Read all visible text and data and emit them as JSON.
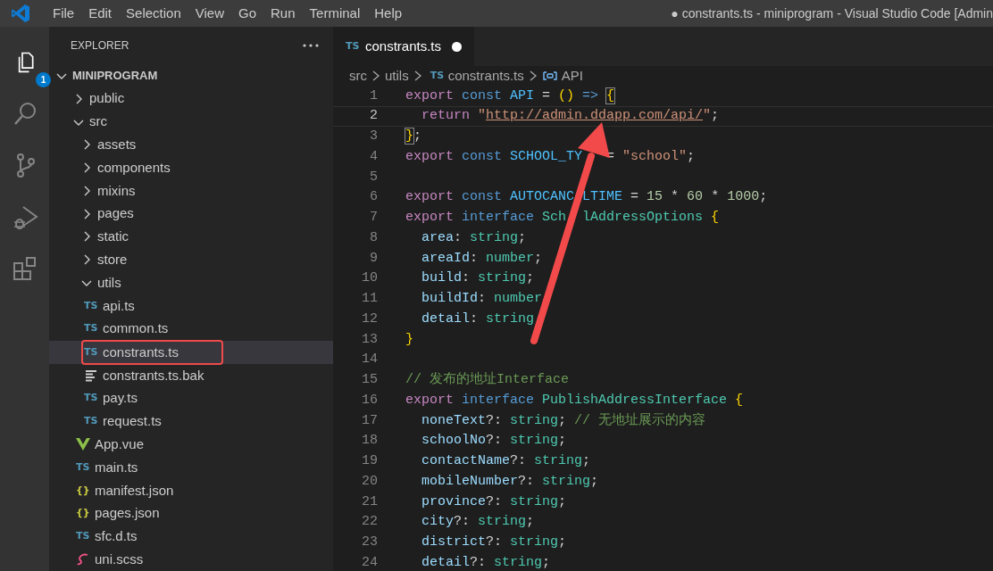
{
  "title_bar": {
    "menus": [
      "File",
      "Edit",
      "Selection",
      "View",
      "Go",
      "Run",
      "Terminal",
      "Help"
    ],
    "title": "● constrants.ts - miniprogram - Visual Studio Code [Admin"
  },
  "activity_bar": {
    "items": [
      {
        "kind": "explorer",
        "selected": true,
        "badge": "1"
      },
      {
        "kind": "search",
        "selected": false
      },
      {
        "kind": "source-control",
        "selected": false
      },
      {
        "kind": "run-debug",
        "selected": false
      },
      {
        "kind": "extensions",
        "selected": false
      }
    ]
  },
  "explorer": {
    "title": "EXPLORER",
    "root": {
      "label": "MINIPROGRAM",
      "expanded": true,
      "children": [
        {
          "kind": "folder",
          "label": "public",
          "expanded": false,
          "selected": false,
          "boxed": false
        },
        {
          "kind": "folder",
          "label": "src",
          "expanded": true,
          "selected": false,
          "boxed": false,
          "children": [
            {
              "kind": "folder",
              "label": "assets",
              "expanded": false,
              "selected": false,
              "boxed": false
            },
            {
              "kind": "folder",
              "label": "components",
              "expanded": false,
              "selected": false,
              "boxed": false
            },
            {
              "kind": "folder",
              "label": "mixins",
              "expanded": false,
              "selected": false,
              "boxed": false
            },
            {
              "kind": "folder",
              "label": "pages",
              "expanded": false,
              "selected": false,
              "boxed": false
            },
            {
              "kind": "folder",
              "label": "static",
              "expanded": false,
              "selected": false,
              "boxed": false
            },
            {
              "kind": "folder",
              "label": "store",
              "expanded": false,
              "selected": false,
              "boxed": false
            },
            {
              "kind": "folder",
              "label": "utils",
              "expanded": true,
              "selected": false,
              "boxed": false,
              "children": [
                {
                  "kind": "ts",
                  "badge": "TS",
                  "label": "api.ts",
                  "selected": false,
                  "boxed": false
                },
                {
                  "kind": "ts",
                  "badge": "TS",
                  "label": "common.ts",
                  "selected": false,
                  "boxed": false
                },
                {
                  "kind": "ts",
                  "badge": "TS",
                  "label": "constrants.ts",
                  "selected": true,
                  "boxed": true
                },
                {
                  "kind": "text",
                  "label": "constrants.ts.bak",
                  "selected": false,
                  "boxed": false
                },
                {
                  "kind": "ts",
                  "badge": "TS",
                  "label": "pay.ts",
                  "selected": false,
                  "boxed": false
                },
                {
                  "kind": "ts",
                  "badge": "TS",
                  "label": "request.ts",
                  "selected": false,
                  "boxed": false
                }
              ]
            },
            {
              "kind": "vue",
              "label": "App.vue",
              "selected": false,
              "boxed": false
            },
            {
              "kind": "ts",
              "badge": "TS",
              "label": "main.ts",
              "selected": false,
              "boxed": false
            },
            {
              "kind": "json",
              "badge": "{}",
              "label": "manifest.json",
              "selected": false,
              "boxed": false
            },
            {
              "kind": "json",
              "badge": "{}",
              "label": "pages.json",
              "selected": false,
              "boxed": false
            },
            {
              "kind": "ts",
              "badge": "TS",
              "label": "sfc.d.ts",
              "selected": false,
              "boxed": false
            },
            {
              "kind": "scss",
              "label": "uni.scss",
              "selected": false,
              "boxed": false
            }
          ]
        }
      ]
    }
  },
  "editor": {
    "tabs": [
      {
        "badge": "TS",
        "label": "constrants.ts",
        "selected": true,
        "modified": true
      }
    ],
    "breadcrumb": [
      {
        "kind": "folder",
        "label": "src"
      },
      {
        "kind": "folder",
        "label": "utils"
      },
      {
        "kind": "file",
        "badge": "TS",
        "label": "constrants.ts"
      },
      {
        "kind": "symbol",
        "label": "API"
      }
    ],
    "lines": [
      {
        "number": "1",
        "current": false,
        "tokens": [
          {
            "kind": "keyword",
            "text": "export"
          },
          {
            "kind": "storage",
            "text": " const"
          },
          {
            "kind": "constant",
            "text": " API"
          },
          {
            "kind": "plain",
            "text": " = "
          },
          {
            "kind": "bracket",
            "text": "()"
          },
          {
            "kind": "storage",
            "text": " => "
          },
          {
            "kind": "bracket-match",
            "text": "{"
          }
        ]
      },
      {
        "number": "2",
        "current": true,
        "tokens": [
          {
            "kind": "keyword",
            "text": "  return"
          },
          {
            "kind": "string",
            "text": " \""
          },
          {
            "kind": "link",
            "text": "http://admin.ddapp.com/api/"
          },
          {
            "kind": "string",
            "text": "\""
          },
          {
            "kind": "plain",
            "text": ";"
          }
        ]
      },
      {
        "number": "3",
        "current": false,
        "tokens": [
          {
            "kind": "bracket-match",
            "text": "}"
          },
          {
            "kind": "plain",
            "text": ";"
          }
        ]
      },
      {
        "number": "4",
        "current": false,
        "tokens": [
          {
            "kind": "keyword",
            "text": "export"
          },
          {
            "kind": "storage",
            "text": " const"
          },
          {
            "kind": "constant",
            "text": " SCHOOL_TY"
          },
          {
            "kind": "covered"
          },
          {
            "kind": "covered"
          },
          {
            "kind": "plain",
            "text": " = "
          },
          {
            "kind": "string",
            "text": "\"school\""
          },
          {
            "kind": "plain",
            "text": ";"
          }
        ]
      },
      {
        "number": "5",
        "current": false
      },
      {
        "number": "6",
        "current": false,
        "tokens": [
          {
            "kind": "keyword",
            "text": "export"
          },
          {
            "kind": "storage",
            "text": " const"
          },
          {
            "kind": "constant",
            "text": " AUTOCANC"
          },
          {
            "kind": "covered"
          },
          {
            "kind": "constant",
            "text": "LTIME"
          },
          {
            "kind": "plain",
            "text": " = "
          },
          {
            "kind": "number",
            "text": "15"
          },
          {
            "kind": "plain",
            "text": " * "
          },
          {
            "kind": "number",
            "text": "60"
          },
          {
            "kind": "plain",
            "text": " * "
          },
          {
            "kind": "number",
            "text": "1000"
          },
          {
            "kind": "plain",
            "text": ";"
          }
        ]
      },
      {
        "number": "7",
        "current": false,
        "tokens": [
          {
            "kind": "keyword",
            "text": "export"
          },
          {
            "kind": "storage",
            "text": " interface"
          },
          {
            "kind": "type",
            "text": " Sch"
          },
          {
            "kind": "covered"
          },
          {
            "kind": "covered"
          },
          {
            "kind": "type",
            "text": "lAddressOptions"
          },
          {
            "kind": "bracket",
            "text": " {"
          }
        ]
      },
      {
        "number": "8",
        "current": false,
        "tokens": [
          {
            "kind": "property",
            "text": "  area"
          },
          {
            "kind": "plain",
            "text": ": "
          },
          {
            "kind": "type",
            "text": "string"
          },
          {
            "kind": "plain",
            "text": ";"
          }
        ]
      },
      {
        "number": "9",
        "current": false,
        "tokens": [
          {
            "kind": "property",
            "text": "  areaId"
          },
          {
            "kind": "plain",
            "text": ": "
          },
          {
            "kind": "type",
            "text": "number"
          },
          {
            "kind": "plain",
            "text": ";"
          }
        ]
      },
      {
        "number": "10",
        "current": false,
        "tokens": [
          {
            "kind": "property",
            "text": "  build"
          },
          {
            "kind": "plain",
            "text": ": "
          },
          {
            "kind": "type",
            "text": "string"
          },
          {
            "kind": "plain",
            "text": ";"
          }
        ]
      },
      {
        "number": "11",
        "current": false,
        "tokens": [
          {
            "kind": "property",
            "text": "  buildId"
          },
          {
            "kind": "plain",
            "text": ": "
          },
          {
            "kind": "type",
            "text": "number"
          },
          {
            "kind": "covered"
          }
        ]
      },
      {
        "number": "12",
        "current": false,
        "tokens": [
          {
            "kind": "property",
            "text": "  detail"
          },
          {
            "kind": "plain",
            "text": ": "
          },
          {
            "kind": "type",
            "text": "string"
          },
          {
            "kind": "covered"
          }
        ]
      },
      {
        "number": "13",
        "current": false,
        "tokens": [
          {
            "kind": "bracket",
            "text": "}"
          }
        ]
      },
      {
        "number": "14",
        "current": false
      },
      {
        "number": "15",
        "current": false,
        "tokens": [
          {
            "kind": "comment",
            "text": "// 发布的地址Interface"
          }
        ]
      },
      {
        "number": "16",
        "current": false,
        "tokens": [
          {
            "kind": "keyword",
            "text": "export"
          },
          {
            "kind": "storage",
            "text": " interface"
          },
          {
            "kind": "type",
            "text": " PublishAddressInterface"
          },
          {
            "kind": "bracket",
            "text": " {"
          }
        ]
      },
      {
        "number": "17",
        "current": false,
        "tokens": [
          {
            "kind": "property",
            "text": "  noneText"
          },
          {
            "kind": "plain",
            "text": "?: "
          },
          {
            "kind": "type",
            "text": "string"
          },
          {
            "kind": "plain",
            "text": ";"
          },
          {
            "kind": "comment",
            "text": " // 无地址展示的内容"
          }
        ]
      },
      {
        "number": "18",
        "current": false,
        "tokens": [
          {
            "kind": "property",
            "text": "  schoolNo"
          },
          {
            "kind": "plain",
            "text": "?: "
          },
          {
            "kind": "type",
            "text": "string"
          },
          {
            "kind": "plain",
            "text": ";"
          }
        ]
      },
      {
        "number": "19",
        "current": false,
        "tokens": [
          {
            "kind": "property",
            "text": "  contactName"
          },
          {
            "kind": "plain",
            "text": "?: "
          },
          {
            "kind": "type",
            "text": "string"
          },
          {
            "kind": "plain",
            "text": ";"
          }
        ]
      },
      {
        "number": "20",
        "current": false,
        "tokens": [
          {
            "kind": "property",
            "text": "  mobileNumber"
          },
          {
            "kind": "plain",
            "text": "?: "
          },
          {
            "kind": "type",
            "text": "string"
          },
          {
            "kind": "plain",
            "text": ";"
          }
        ]
      },
      {
        "number": "21",
        "current": false,
        "tokens": [
          {
            "kind": "property",
            "text": "  province"
          },
          {
            "kind": "plain",
            "text": "?: "
          },
          {
            "kind": "type",
            "text": "string"
          },
          {
            "kind": "plain",
            "text": ";"
          }
        ]
      },
      {
        "number": "22",
        "current": false,
        "tokens": [
          {
            "kind": "property",
            "text": "  city"
          },
          {
            "kind": "plain",
            "text": "?: "
          },
          {
            "kind": "type",
            "text": "string"
          },
          {
            "kind": "plain",
            "text": ";"
          }
        ]
      },
      {
        "number": "23",
        "current": false,
        "tokens": [
          {
            "kind": "property",
            "text": "  district"
          },
          {
            "kind": "plain",
            "text": "?: "
          },
          {
            "kind": "type",
            "text": "string"
          },
          {
            "kind": "plain",
            "text": ";"
          }
        ]
      },
      {
        "number": "24",
        "current": false,
        "tokens": [
          {
            "kind": "property",
            "text": "  detail"
          },
          {
            "kind": "plain",
            "text": "?: "
          },
          {
            "kind": "type",
            "text": "string"
          },
          {
            "kind": "plain",
            "text": ";"
          }
        ]
      }
    ]
  },
  "annotation": {
    "kind": "arrow",
    "color": "#f24a4a"
  }
}
